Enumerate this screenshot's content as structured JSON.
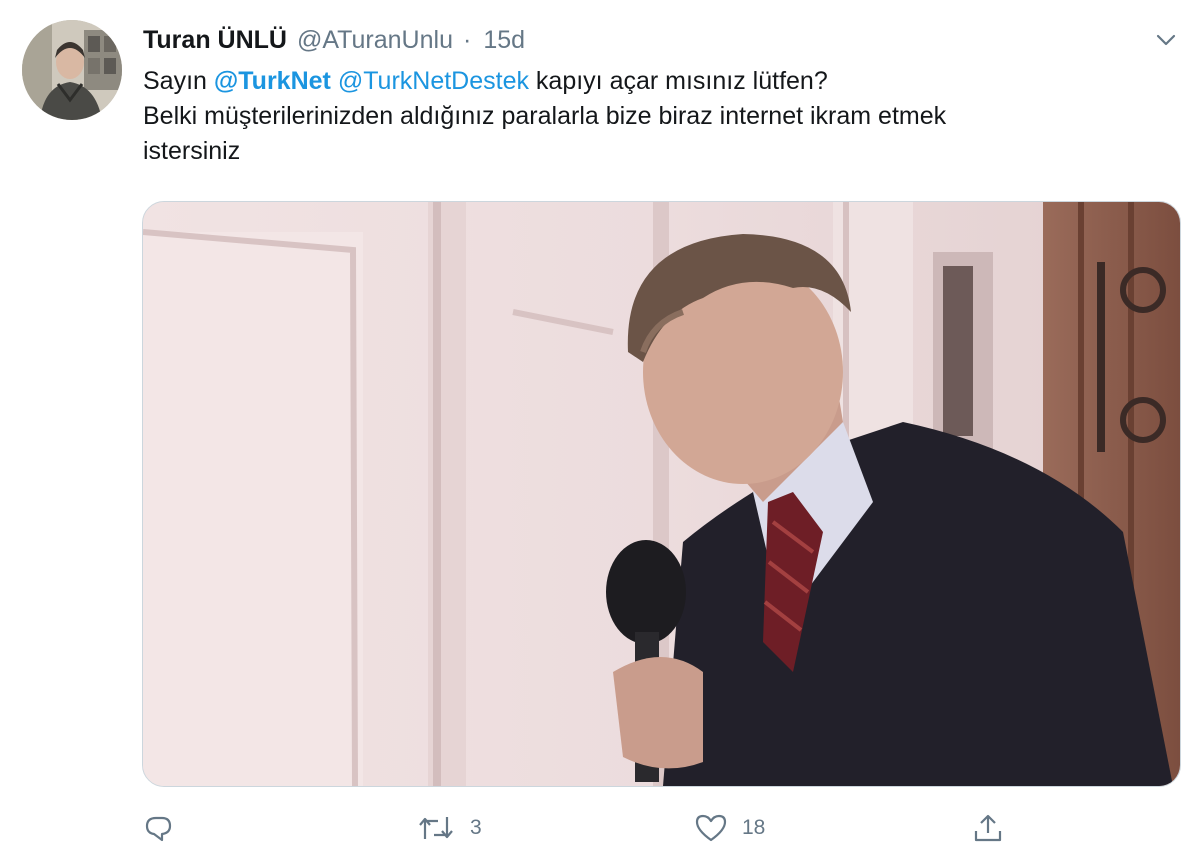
{
  "tweet": {
    "display_name": "Turan ÜNLÜ",
    "handle": "@ATuranUnlu",
    "separator": "·",
    "time": "15d",
    "text": {
      "line1_prefix": "Sayın ",
      "mention1": "@TurkNet",
      "space": " ",
      "mention2": "@TurkNetDestek",
      "line1_suffix": " kapıyı açar mısınız lütfen?",
      "line2": "Belki müşterilerinizden aldığınız paralarla bize biraz internet ikram etmek",
      "line3": "istersiniz"
    },
    "avatar_icon": "profile-photo",
    "menu_icon": "chevron-down-icon",
    "media_icon": "video-thumbnail"
  },
  "actions": {
    "reply": {
      "icon": "reply-icon",
      "count": ""
    },
    "retweet": {
      "icon": "retweet-icon",
      "count": "3"
    },
    "like": {
      "icon": "heart-icon",
      "count": "18"
    },
    "share": {
      "icon": "share-icon",
      "count": ""
    }
  },
  "colors": {
    "link": "#1b95e0",
    "muted": "#657786",
    "text": "#14171a"
  }
}
